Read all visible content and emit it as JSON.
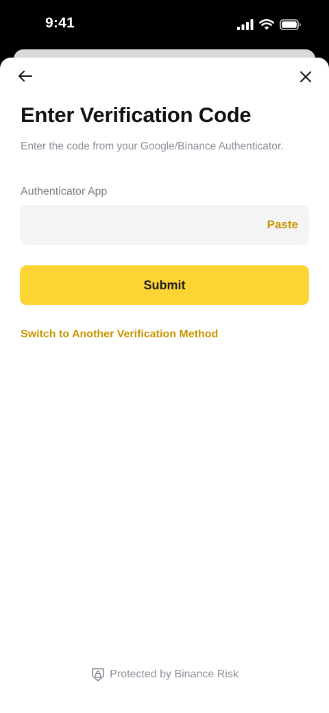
{
  "status_bar": {
    "time": "9:41",
    "signal_icon": "cellular-signal-icon",
    "wifi_icon": "wifi-icon",
    "battery_icon": "battery-icon"
  },
  "nav": {
    "back_icon": "arrow-left-icon",
    "close_icon": "close-icon"
  },
  "page": {
    "title": "Enter Verification Code",
    "subtitle": "Enter the code from your Google/Binance Authenticator."
  },
  "field": {
    "label": "Authenticator App",
    "value": "",
    "placeholder": "",
    "paste_label": "Paste"
  },
  "submit_label": "Submit",
  "switch_method_label": "Switch to Another Verification Method",
  "footer": {
    "icon": "shield-lock-icon",
    "text": "Protected by Binance Risk"
  },
  "colors": {
    "accent": "#FCD535",
    "link": "#C99400",
    "text_primary": "#111111",
    "text_secondary": "#8A8F98",
    "field_bg": "#F4F4F4"
  }
}
